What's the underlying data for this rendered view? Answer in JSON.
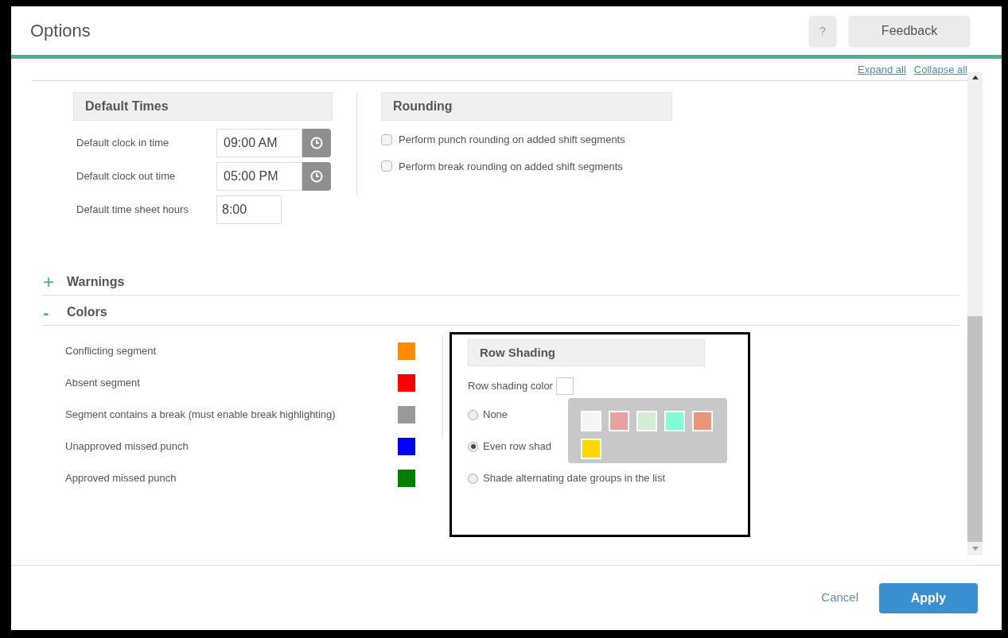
{
  "dialog": {
    "title": "Options",
    "help_button": "?",
    "feedback_button": "Feedback"
  },
  "links": {
    "expand_all": "Expand all",
    "collapse_all": "Collapse all"
  },
  "default_times": {
    "heading": "Default Times",
    "fields": [
      {
        "kind": "time",
        "label": "Default clock in time",
        "value": "09:00 AM"
      },
      {
        "kind": "time",
        "label": "Default clock out time",
        "value": "05:00 PM"
      },
      {
        "kind": "text",
        "label": "Default time sheet hours",
        "value": "8:00"
      }
    ]
  },
  "rounding": {
    "heading": "Rounding",
    "options": [
      {
        "label": "Perform punch rounding on added shift segments",
        "checked": false
      },
      {
        "label": "Perform break rounding on added shift segments",
        "checked": false
      }
    ]
  },
  "sections": [
    {
      "toggle": "+",
      "title": "Warnings",
      "expanded": false
    },
    {
      "toggle": "-",
      "title": "Colors",
      "expanded": true
    }
  ],
  "colors": [
    {
      "label": "Conflicting segment",
      "color": "#ff8c00"
    },
    {
      "label": "Absent segment",
      "color": "#ff0000"
    },
    {
      "label": "Segment contains a break (must enable break highlighting)",
      "color": "#999999"
    },
    {
      "label": "Unapproved missed punch",
      "color": "#0000ff"
    },
    {
      "label": "Approved missed punch",
      "color": "#008000"
    }
  ],
  "row_shading": {
    "heading": "Row Shading",
    "color_label": "Row shading color",
    "options": [
      {
        "label": "None",
        "selected": false
      },
      {
        "label": "Even row shad",
        "selected": true
      },
      {
        "label": "Shade alternating date groups in the list",
        "selected": false
      }
    ],
    "palette": [
      {
        "color": "#f5f5f5"
      },
      {
        "color": "#e8a0a0"
      },
      {
        "color": "#d4ecd4"
      },
      {
        "color": "#7fffd4"
      },
      {
        "color": "#e9967a"
      },
      {
        "color": "#ffd700"
      }
    ]
  },
  "footer": {
    "cancel": "Cancel",
    "apply": "Apply"
  }
}
